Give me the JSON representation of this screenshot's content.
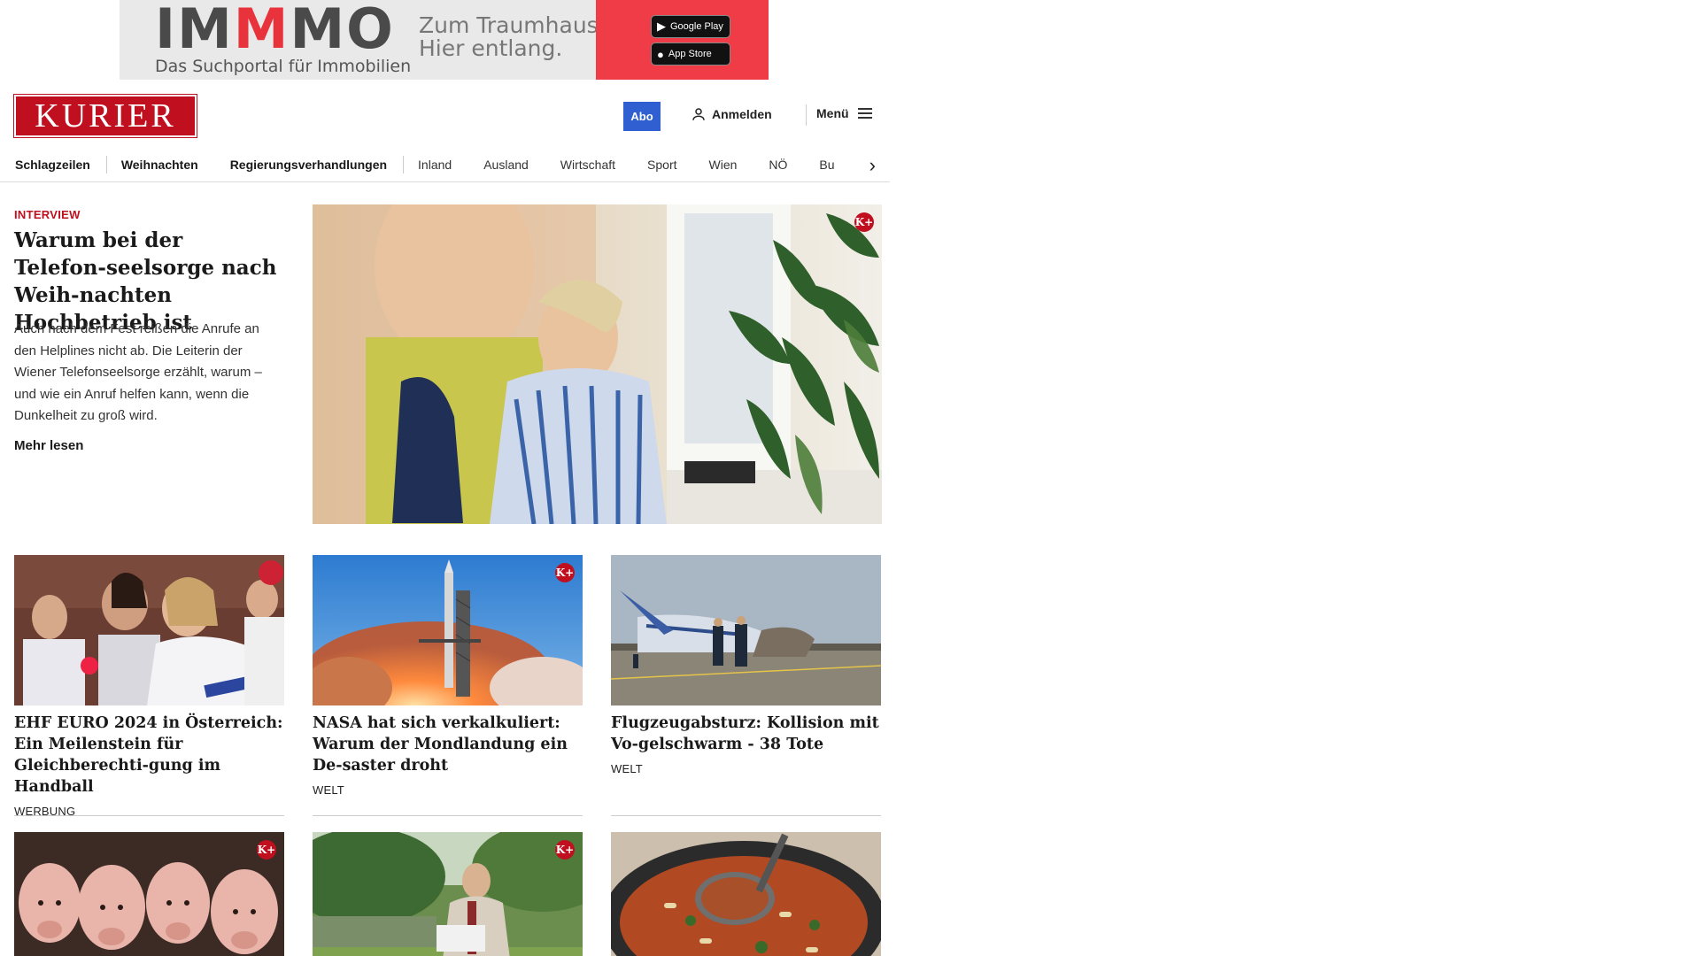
{
  "ad": {
    "logo_pre": "IM",
    "logo_red": "M",
    "logo_post": "MO",
    "subtitle": "Das Suchportal für Immobilien",
    "slogan_line1": "Zum Traumhaus?",
    "slogan_line2": "Hier entlang.",
    "google_play": "Google Play",
    "app_store": "App Store"
  },
  "header": {
    "logo": "KURIER",
    "abo": "Abo",
    "login": "Anmelden",
    "menu": "Menü"
  },
  "nav": {
    "items": [
      "Schlagzeilen",
      "Weihnachten",
      "Regierungsverhandlungen",
      "Inland",
      "Ausland",
      "Wirtschaft",
      "Sport",
      "Wien",
      "NÖ",
      "Bu"
    ]
  },
  "hero": {
    "kicker": "INTERVIEW",
    "title": "Warum bei der Telefon-seelsorge nach Weih-nachten Hochbetrieb ist",
    "teaser": "Auch nach dem Fest reißen die Anrufe an den Helplines nicht ab. Die Leiterin der Wiener Telefonseelsorge erzählt, warum – und wie ein Anruf helfen kann, wenn die Dunkelheit zu groß wird.",
    "more": "Mehr lesen",
    "badge": "K+"
  },
  "cards": [
    {
      "title": "EHF EURO 2024 in Österreich: Ein Meilenstein für Gleichberechti-gung im Handball",
      "tag": "WERBUNG",
      "badge": ""
    },
    {
      "title": "NASA hat sich verkalkuliert: Warum der Mondlandung ein De-saster droht",
      "tag": "WELT",
      "badge": "K+"
    },
    {
      "title": "Flugzeugabsturz: Kollision mit Vo-gelschwarm - 38 Tote",
      "tag": "WELT",
      "badge": ""
    }
  ],
  "row2_badges": [
    "K+",
    "K+",
    ""
  ],
  "colors": {
    "brand_red": "#c0101f",
    "abo_blue": "#2f5fd0"
  }
}
